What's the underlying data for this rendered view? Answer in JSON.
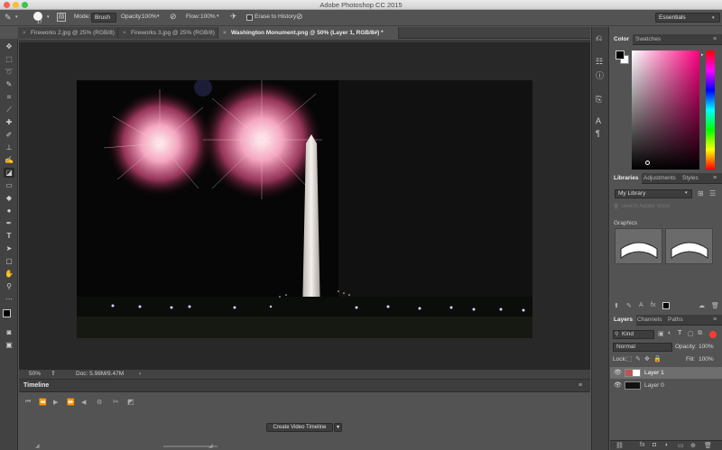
{
  "app": {
    "title": "Adobe Photoshop CC 2015"
  },
  "options_bar": {
    "brush_size": "17",
    "mode_label": "Mode:",
    "mode_value": "Brush",
    "opacity_label": "Opacity:",
    "opacity_value": "100%",
    "flow_label": "Flow:",
    "flow_value": "100%",
    "erase_history_label": "Erase to History",
    "workspace": "Essentials"
  },
  "doc_tabs": [
    {
      "label": "Fireworks 2.jpg @ 25% (RGB/8)",
      "active": false
    },
    {
      "label": "Fireworks 3.jpg @ 25% (RGB/8)",
      "active": false
    },
    {
      "label": "Washington Monument.png @ 50% (Layer 1, RGB/8#) *",
      "active": true
    }
  ],
  "status": {
    "zoom": "50%",
    "doc": "Doc: 5.98M/9.47M"
  },
  "timeline": {
    "title": "Timeline",
    "create_button": "Create Video Timeline"
  },
  "color_panel": {
    "tabs": [
      "Color",
      "Swatches"
    ]
  },
  "libraries_panel": {
    "tabs": [
      "Libraries",
      "Adjustments",
      "Styles"
    ],
    "library_name": "My Library",
    "search_placeholder": "Search Adobe Stock",
    "section": "Graphics"
  },
  "layers_panel": {
    "tabs": [
      "Layers",
      "Channels",
      "Paths"
    ],
    "kind": "Kind",
    "blend_mode": "Normal",
    "opacity_label": "Opacity:",
    "opacity_value": "100%",
    "lock_label": "Lock:",
    "fill_label": "Fill:",
    "fill_value": "100%",
    "layers": [
      {
        "name": "Layer 1",
        "selected": true
      },
      {
        "name": "Layer 0",
        "selected": false
      }
    ]
  },
  "colors": {
    "accent_red": "#ff3b30",
    "chrome_dark": "#424242",
    "chrome_mid": "#535353"
  }
}
